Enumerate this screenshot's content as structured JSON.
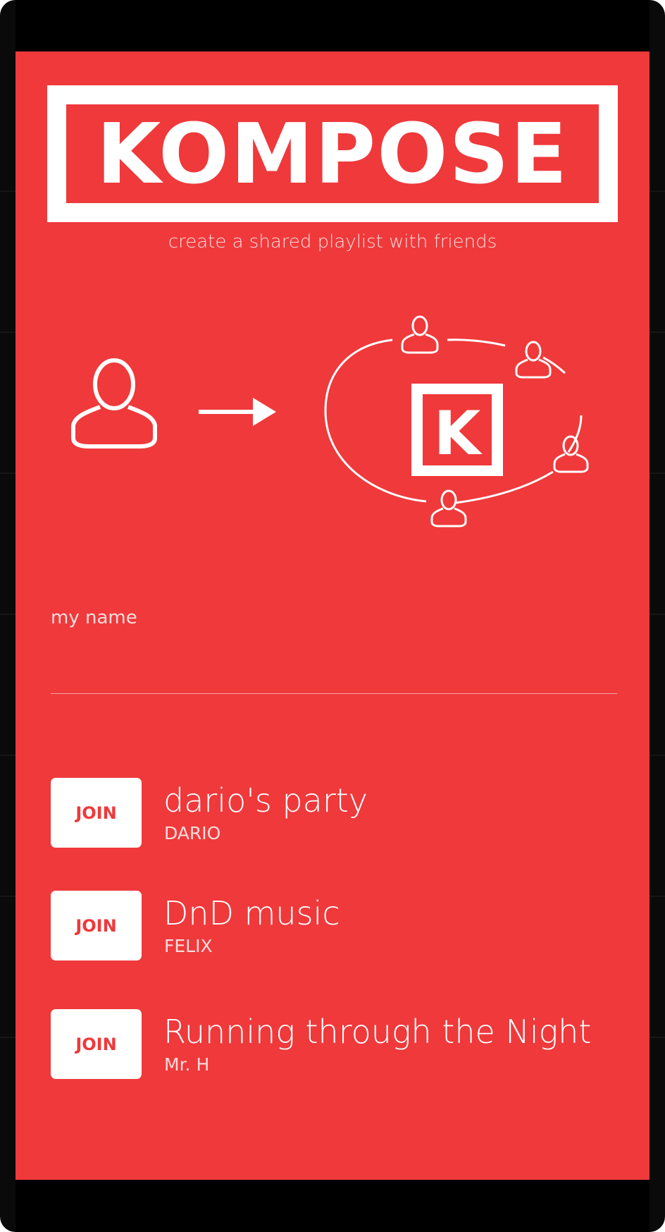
{
  "app": {
    "logo_text": "KOMPOSE",
    "tagline": "create a shared playlist with friends",
    "brand_color": "#ef393b"
  },
  "illustration": {
    "icons": [
      "user-icon",
      "arrow-right-icon",
      "kompose-k-icon",
      "group-users-icon"
    ],
    "center_letter": "K"
  },
  "form": {
    "name_label": "my name",
    "name_value": ""
  },
  "parties": [
    {
      "title": "dario's party",
      "owner": "DARIO",
      "button": "JOIN"
    },
    {
      "title": "DnD music",
      "owner": "FELIX",
      "button": "JOIN"
    },
    {
      "title": "Running through the Night",
      "owner": "Mr. H",
      "button": "JOIN"
    }
  ]
}
